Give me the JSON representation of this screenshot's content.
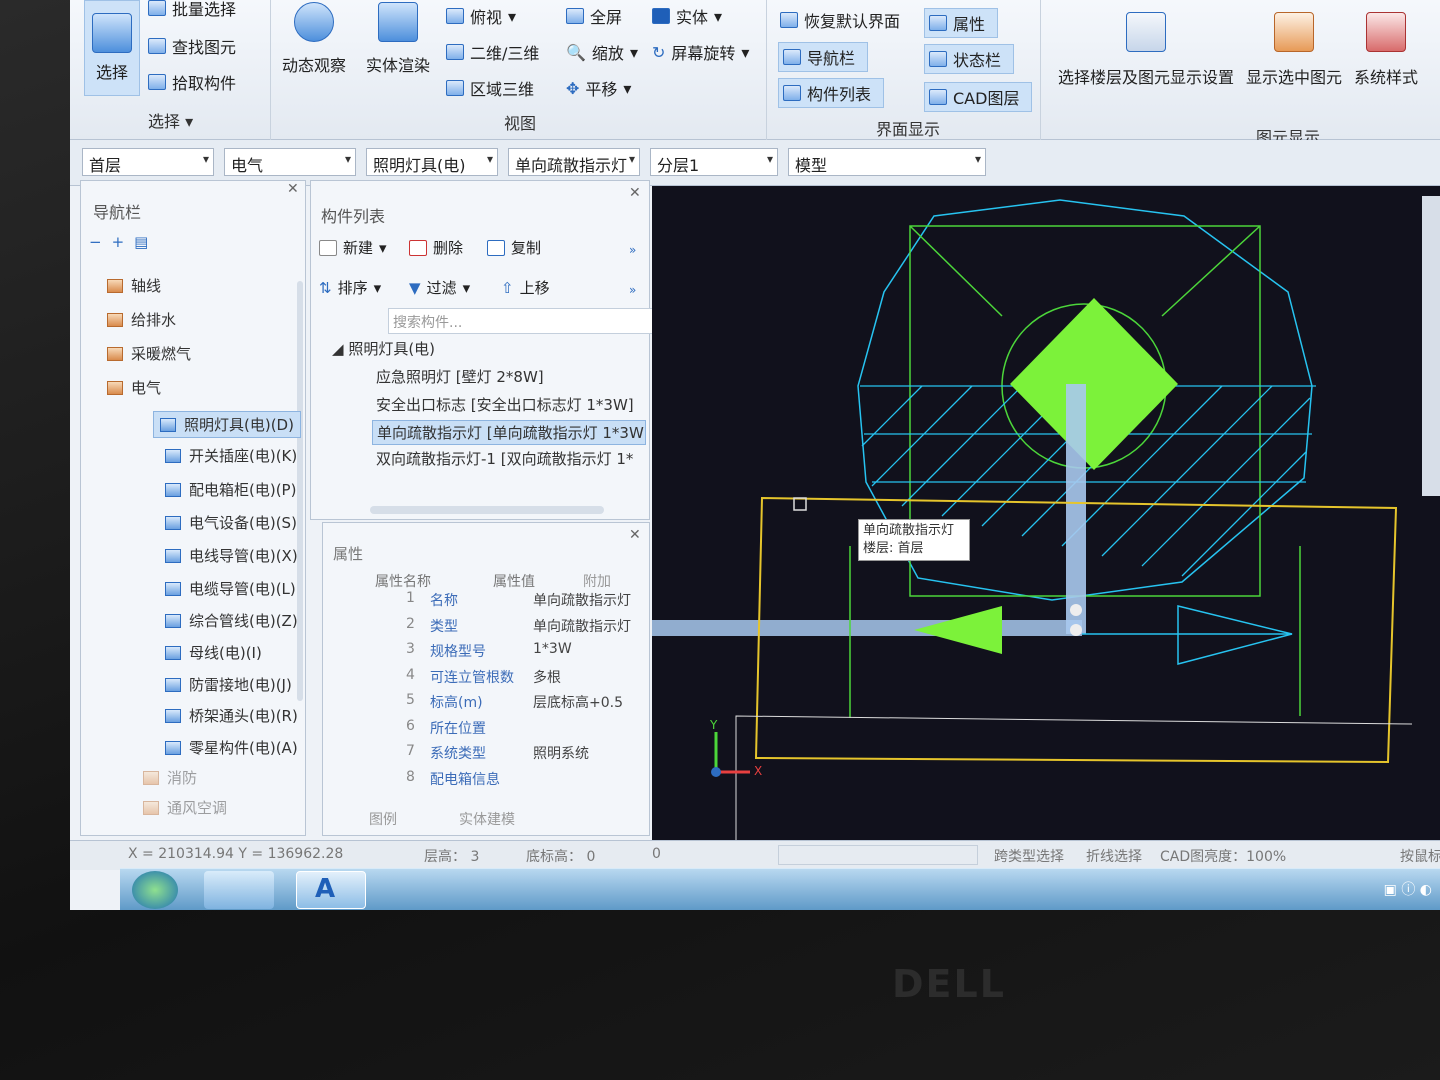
{
  "ribbon": {
    "select_group": {
      "select_label": "选择",
      "batch_select": "批量选择",
      "find_element": "查找图元",
      "pick_component": "拾取构件",
      "group_label": "选择"
    },
    "view_group": {
      "orbit": "动态观察",
      "solid_render": "实体渲染",
      "top_view": "俯视",
      "two_three_d": "二维/三维",
      "region_3d": "区域三维",
      "fullscreen": "全屏",
      "zoom": "缩放",
      "pan": "平移",
      "solid": "实体",
      "screen_rotate": "屏幕旋转",
      "group_label": "视图"
    },
    "ui_group": {
      "restore_default": "恢复默认界面",
      "nav_bar": "导航栏",
      "component_list": "构件列表",
      "properties": "属性",
      "status_bar": "状态栏",
      "cad_layer": "CAD图层",
      "group_label": "界面显示"
    },
    "element_group": {
      "floor_display_settings": "选择楼层及图元显示设置",
      "show_selected": "显示选中图元",
      "system_style": "系统样式",
      "group_label": "图元显示"
    }
  },
  "combos": {
    "floor": "首层",
    "discipline": "电气",
    "category": "照明灯具(电)",
    "component": "单向疏散指示灯",
    "layer": "分层1",
    "mode": "模型"
  },
  "nav_panel": {
    "title": "导航栏",
    "items": [
      "轴线",
      "给排水",
      "采暖燃气",
      "电气",
      "照明灯具(电)(D)",
      "开关插座(电)(K)",
      "配电箱柜(电)(P)",
      "电气设备(电)(S)",
      "电线导管(电)(X)",
      "电缆导管(电)(L)",
      "综合管线(电)(Z)",
      "母线(电)(I)",
      "防雷接地(电)(J)",
      "桥架通头(电)(R)",
      "零星构件(电)(A)",
      "消防",
      "通风空调"
    ]
  },
  "component_panel": {
    "title": "构件列表",
    "new": "新建",
    "delete": "删除",
    "copy": "复制",
    "sort": "排序",
    "filter": "过滤",
    "move_up": "上移",
    "search_placeholder": "搜索构件...",
    "tree_root": "照明灯具(电)",
    "items": [
      "应急照明灯 [壁灯 2*8W]",
      "安全出口标志 [安全出口标志灯 1*3W]",
      "单向疏散指示灯 [单向疏散指示灯 1*3W",
      "双向疏散指示灯-1 [双向疏散指示灯 1*"
    ]
  },
  "properties_panel": {
    "title": "属性",
    "headers": {
      "name": "属性名称",
      "value": "属性值",
      "extra": "附加"
    },
    "rows": [
      {
        "n": "1",
        "k": "名称",
        "v": "单向疏散指示灯",
        "checked": false
      },
      {
        "n": "2",
        "k": "类型",
        "v": "单向疏散指示灯",
        "checked": true
      },
      {
        "n": "3",
        "k": "规格型号",
        "v": "1*3W",
        "checked": true
      },
      {
        "n": "4",
        "k": "可连立管根数",
        "v": "多根",
        "checked": false
      },
      {
        "n": "5",
        "k": "标高(m)",
        "v": "层底标高+0.5",
        "checked": false
      },
      {
        "n": "6",
        "k": "所在位置",
        "v": "",
        "checked": false
      },
      {
        "n": "7",
        "k": "系统类型",
        "v": "照明系统",
        "checked": false
      },
      {
        "n": "8",
        "k": "配电箱信息",
        "v": "",
        "checked": false
      }
    ],
    "tab_legend": "图例",
    "tab_solid": "实体建模"
  },
  "canvas": {
    "tooltip_line1": "单向疏散指示灯",
    "tooltip_line2": "楼层: 首层",
    "axis_x": "X",
    "axis_y": "Y"
  },
  "status_bar": {
    "coords": "X = 210314.94 Y = 136962.28",
    "floor_height": "层高： 3",
    "base_height": "底标高： 0",
    "zero": "0",
    "cross_type_select": "跨类型选择",
    "polyline_select": "折线选择",
    "cad_brightness": "CAD图亮度：100%",
    "press_mouse": "按鼠标"
  },
  "taskbar": {
    "app_letter": "A"
  },
  "monitor": {
    "brand": "DELL"
  },
  "colors": {
    "ribbon_bg": "#e3e9f1",
    "canvas_bg": "#11111c",
    "fixture_green": "#7cf23a",
    "cyan_lines": "#27c3f0",
    "yellow_frame": "#e6c52c"
  }
}
